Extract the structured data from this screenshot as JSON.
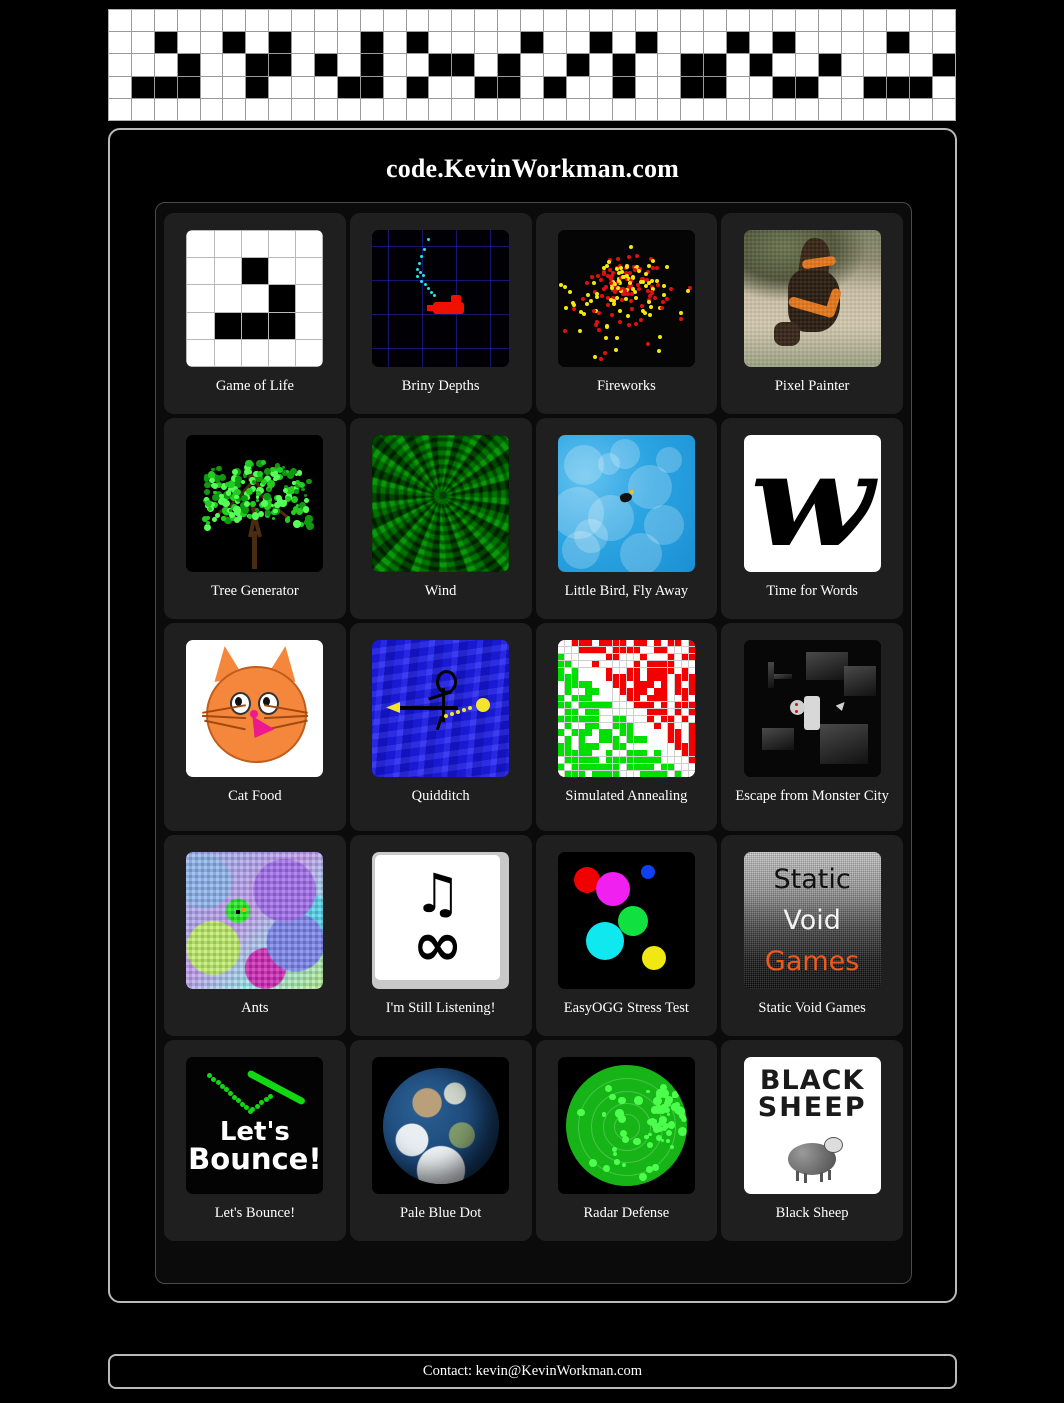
{
  "site": {
    "title": "code.KevinWorkman.com",
    "footer_text": "Contact: kevin@KevinWorkman.com"
  },
  "banner": {
    "name": "game-of-life-banner",
    "rows": 5,
    "cols": 37,
    "live_cells": [
      [
        1,
        2
      ],
      [
        1,
        5
      ],
      [
        1,
        7
      ],
      [
        1,
        11
      ],
      [
        1,
        13
      ],
      [
        1,
        18
      ],
      [
        1,
        21
      ],
      [
        1,
        23
      ],
      [
        1,
        27
      ],
      [
        1,
        29
      ],
      [
        1,
        34
      ],
      [
        2,
        3
      ],
      [
        2,
        6
      ],
      [
        2,
        7
      ],
      [
        2,
        9
      ],
      [
        2,
        11
      ],
      [
        2,
        14
      ],
      [
        2,
        15
      ],
      [
        2,
        17
      ],
      [
        2,
        20
      ],
      [
        2,
        22
      ],
      [
        2,
        25
      ],
      [
        2,
        26
      ],
      [
        2,
        28
      ],
      [
        2,
        31
      ],
      [
        2,
        36
      ],
      [
        3,
        1
      ],
      [
        3,
        2
      ],
      [
        3,
        3
      ],
      [
        3,
        6
      ],
      [
        3,
        10
      ],
      [
        3,
        11
      ],
      [
        3,
        13
      ],
      [
        3,
        16
      ],
      [
        3,
        17
      ],
      [
        3,
        19
      ],
      [
        3,
        22
      ],
      [
        3,
        25
      ],
      [
        3,
        26
      ],
      [
        3,
        29
      ],
      [
        3,
        30
      ],
      [
        3,
        33
      ],
      [
        3,
        34
      ],
      [
        3,
        35
      ]
    ]
  },
  "tiles": [
    {
      "label": "Game of Life",
      "art": "game-of-life"
    },
    {
      "label": "Briny Depths",
      "art": "briny-depths"
    },
    {
      "label": "Fireworks",
      "art": "fireworks"
    },
    {
      "label": "Pixel Painter",
      "art": "pixel-painter"
    },
    {
      "label": "Tree Generator",
      "art": "tree-generator"
    },
    {
      "label": "Wind",
      "art": "wind"
    },
    {
      "label": "Little Bird, Fly Away",
      "art": "little-bird"
    },
    {
      "label": "Time for Words",
      "art": "time-for-words"
    },
    {
      "label": "Cat Food",
      "art": "cat-food"
    },
    {
      "label": "Quidditch",
      "art": "quidditch"
    },
    {
      "label": "Simulated Annealing",
      "art": "simulated-annealing"
    },
    {
      "label": "Escape from Monster City",
      "art": "monster-city"
    },
    {
      "label": "Ants",
      "art": "ants"
    },
    {
      "label": "I'm Still Listening!",
      "art": "still-listening"
    },
    {
      "label": "EasyOGG Stress Test",
      "art": "easyogg"
    },
    {
      "label": "Static Void Games",
      "art": "static-void-games"
    },
    {
      "label": "Let's Bounce!",
      "art": "lets-bounce"
    },
    {
      "label": "Pale Blue Dot",
      "art": "pale-blue-dot"
    },
    {
      "label": "Radar Defense",
      "art": "radar-defense"
    },
    {
      "label": "Black Sheep",
      "art": "black-sheep"
    }
  ],
  "art_text": {
    "time_for_words_letter": "w",
    "static_void_games": [
      "Static",
      "Void",
      "Games"
    ],
    "lets_bounce": [
      "Let's",
      "Bounce!"
    ],
    "black_sheep": [
      "BLACK",
      "SHEEP"
    ],
    "still_listening_note": "♫",
    "still_listening_infinity": "∞"
  },
  "colors": {
    "page_background": "#000000",
    "panel_border": "#b9b9b9",
    "tile_background": "#1f1f1f",
    "tile_frame_border": "#4a4a4a",
    "text": "#ffffff",
    "banner_live": "#000000",
    "banner_dead": "#ffffff"
  }
}
